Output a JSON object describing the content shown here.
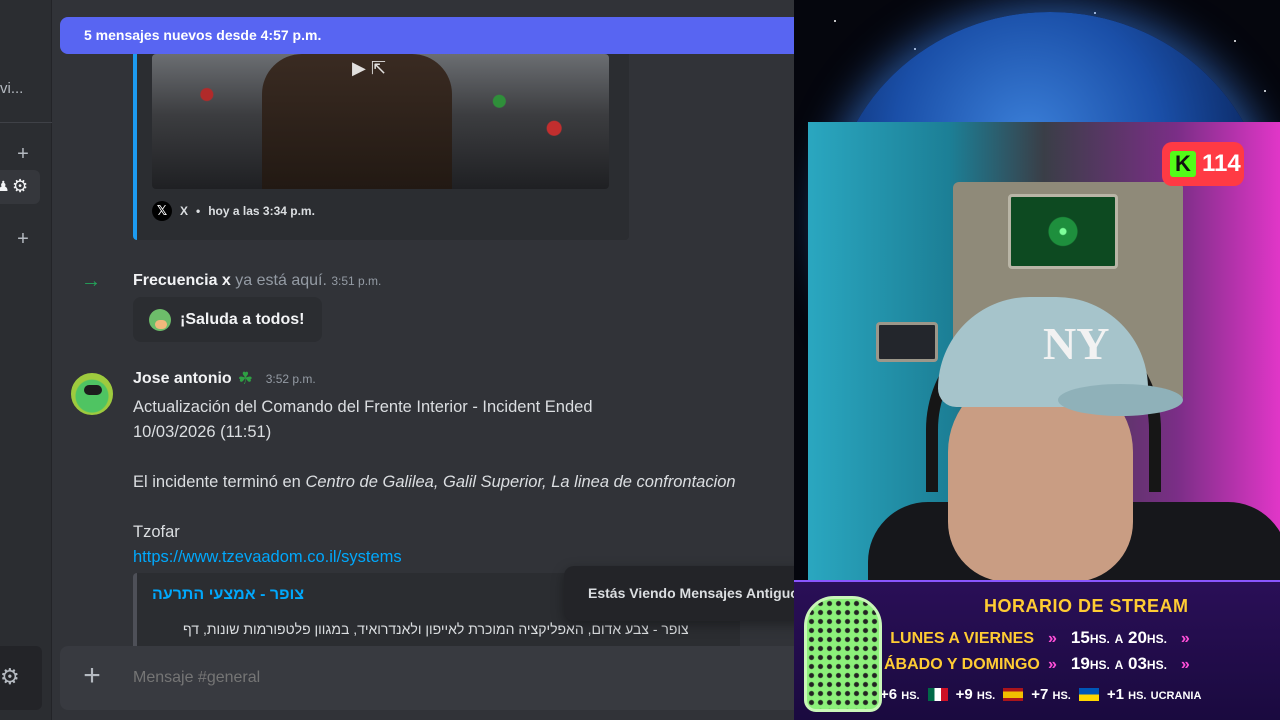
{
  "left_rail": {
    "truncated_label": "vi..."
  },
  "chat": {
    "new_messages_banner": "5 mensajes nuevos desde 4:57 p.m.",
    "embed_x": {
      "source": "X",
      "separator": "•",
      "timestamp": "hoy a las 3:34 p.m."
    },
    "join_message": {
      "name": "Frecuencia x",
      "text": "ya está aquí.",
      "time": "3:51 p.m.",
      "wave_button": "¡Saluda a todos!"
    },
    "message": {
      "author": "Jose antonio",
      "time": "3:52 p.m.",
      "line1": "Actualización del Comando del Frente Interior - Incident Ended",
      "line2": "10/03/2026 (11:51)",
      "line3_prefix": "El incidente terminó en ",
      "line3_italic": "Centro de Galilea, Galil Superior, La linea de confrontacion",
      "line4": "Tzofar",
      "link": "https://www.tzevaadom.co.il/systems",
      "embed_title": "צופר - אמצעי התרעה",
      "embed_desc": "צופר - צבע אדום, האפליקציה המוכרת לאייפון ולאנדרואיד, במגוון פלטפורמות שונות, דף"
    },
    "toast": "Estás Viendo Mensajes Antiguos",
    "composer_placeholder": "Mensaje #general"
  },
  "stream": {
    "viewer_badge": {
      "logo": "K",
      "count": "114"
    },
    "schedule": {
      "title": "HORARIO DE STREAM",
      "rows": [
        {
          "day": "LUNES A VIERNES",
          "from": "15",
          "to": "20",
          "unit": "HS.",
          "sep": "A"
        },
        {
          "day": "ÁBADO Y DOMINGO",
          "from": "19",
          "to": "03",
          "unit": "HS.",
          "sep": "A"
        }
      ],
      "timezones": [
        {
          "offset": "+6",
          "unit": "HS."
        },
        {
          "offset": "+9",
          "unit": "HS."
        },
        {
          "offset": "+7",
          "unit": "HS."
        },
        {
          "offset": "+1",
          "unit": "HS.",
          "label": "UCRANIA"
        }
      ]
    },
    "cap_logo": "NY"
  },
  "colors": {
    "blurple": "#5865f2",
    "link": "#00a8fc",
    "online_green": "#23a55a",
    "kick_green": "#53fc18",
    "badge_red": "#ff3a44"
  }
}
